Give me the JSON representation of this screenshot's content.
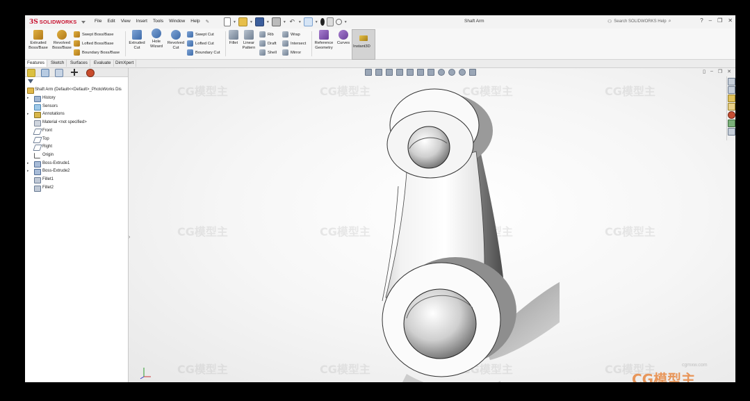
{
  "app": {
    "brand": "SOLIDWORKS",
    "ds_mark": "3S",
    "document_title": "Shaft Arm",
    "help_search_placeholder": "Search SOLIDWORKS Help"
  },
  "menu": [
    "File",
    "Edit",
    "View",
    "Insert",
    "Tools",
    "Window",
    "Help"
  ],
  "ribbon": {
    "extruded_boss": "Extruded Boss/Base",
    "revolved_boss": "Revolved Boss/Base",
    "swept_boss": "Swept Boss/Base",
    "lofted_boss": "Lofted Boss/Base",
    "boundary_boss": "Boundary Boss/Base",
    "extruded_cut": "Extruded Cut",
    "hole_wizard": "Hole Wizard",
    "revolved_cut": "Revolved Cut",
    "swept_cut": "Swept Cut",
    "lofted_cut": "Lofted Cut",
    "boundary_cut": "Boundary Cut",
    "fillet": "Fillet",
    "linear_pattern": "Linear Pattern",
    "rib": "Rib",
    "draft": "Draft",
    "shell": "Shell",
    "wrap": "Wrap",
    "intersect": "Intersect",
    "mirror": "Mirror",
    "reference_geometry": "Reference Geometry",
    "curves": "Curves",
    "instant3d": "Instant3D"
  },
  "tabs": [
    "Features",
    "Sketch",
    "Surfaces",
    "Evaluate",
    "DimXpert"
  ],
  "active_tab": "Features",
  "tree": {
    "root": "Shaft Arm  (Default<<Default>_PhotoWorks Dis",
    "items": [
      {
        "label": "History",
        "icon": "history-icon",
        "expand": true
      },
      {
        "label": "Sensors",
        "icon": "sensors-icon",
        "expand": false
      },
      {
        "label": "Annotations",
        "icon": "annotations-icon",
        "expand": true
      },
      {
        "label": "Material <not specified>",
        "icon": "material-icon",
        "expand": false
      },
      {
        "label": "Front",
        "icon": "plane-icon",
        "expand": false
      },
      {
        "label": "Top",
        "icon": "plane-icon",
        "expand": false
      },
      {
        "label": "Right",
        "icon": "plane-icon",
        "expand": false
      },
      {
        "label": "Origin",
        "icon": "origin-icon",
        "expand": false
      },
      {
        "label": "Boss-Extrude1",
        "icon": "extrude-feature-icon",
        "expand": true
      },
      {
        "label": "Boss-Extrude2",
        "icon": "extrude-feature-icon",
        "expand": true
      },
      {
        "label": "Fillet1",
        "icon": "fillet-feature-icon",
        "expand": false
      },
      {
        "label": "Fillet2",
        "icon": "fillet-feature-icon",
        "expand": false
      }
    ]
  },
  "watermark": {
    "text": "CG模型主",
    "site": "cgmxw.com"
  },
  "colors": {
    "accent": "#c8102e",
    "ribbon_bg": "#f7f7f7",
    "viewport_bg": "#f4f4f4"
  }
}
